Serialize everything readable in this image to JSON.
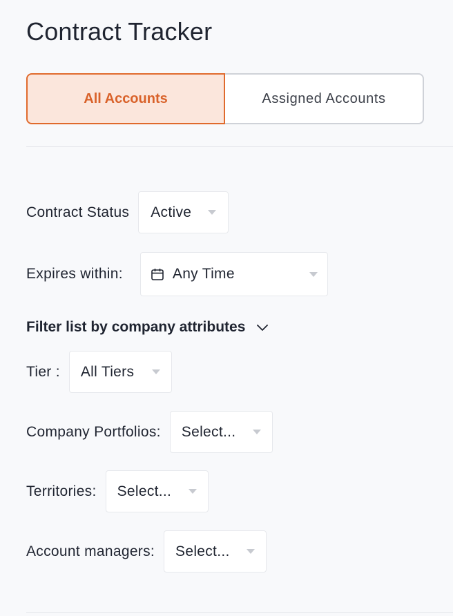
{
  "page": {
    "title": "Contract Tracker"
  },
  "tabs": [
    {
      "label": "All Accounts",
      "active": true
    },
    {
      "label": "Assigned Accounts",
      "active": false
    }
  ],
  "filters": {
    "contract_status": {
      "label": "Contract Status",
      "value": "Active"
    },
    "expires_within": {
      "label": "Expires within:",
      "value": "Any Time",
      "icon": "calendar-icon"
    },
    "company_attributes_heading": "Filter list by company attributes",
    "tier": {
      "label": "Tier :",
      "value": "All Tiers"
    },
    "company_portfolios": {
      "label": "Company Portfolios:",
      "value": "Select..."
    },
    "territories": {
      "label": "Territories:",
      "value": "Select..."
    },
    "account_managers": {
      "label": "Account managers:",
      "value": "Select..."
    }
  },
  "colors": {
    "accent": "#e06a2c",
    "accent_bg": "#fbe6dc",
    "page_bg": "#f8f9fb"
  }
}
